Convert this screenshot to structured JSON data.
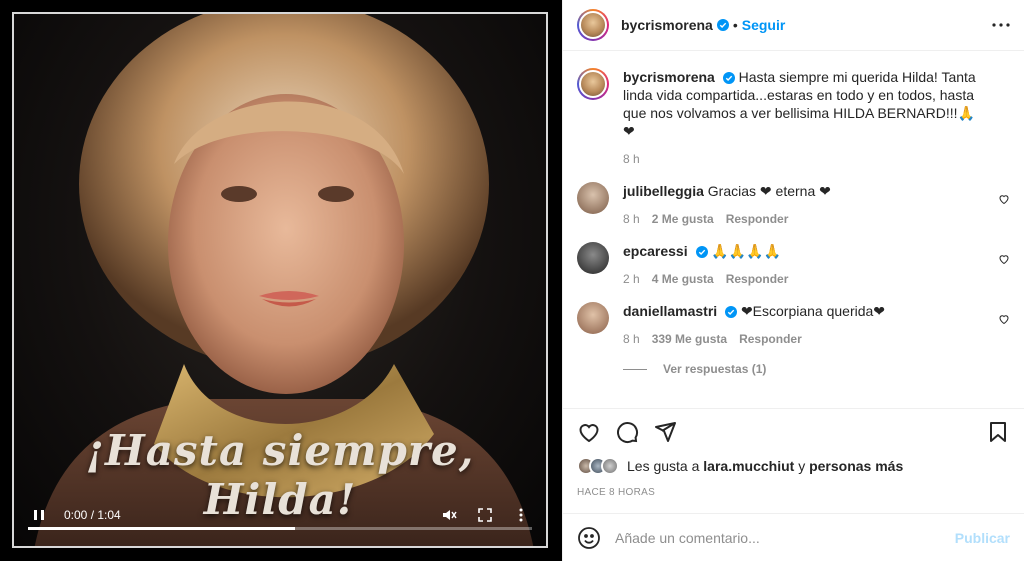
{
  "video": {
    "overlay_text": "¡Hasta siempre, Hilda!",
    "time": "0:00 / 1:04",
    "progress_fraction": 0.53,
    "icons": [
      "pause-icon",
      "mute-icon",
      "fullscreen-icon",
      "more-icon"
    ]
  },
  "header": {
    "username": "bycrismorena",
    "separator": "•",
    "follow_label": "Seguir"
  },
  "caption": {
    "username": "bycrismorena",
    "text": "Hasta siempre mi querida Hilda! Tanta linda vida compartida...estaras en todo y en todos, hasta que nos volvamos a ver bellisima HILDA BERNARD!!!🙏❤",
    "time": "8 h"
  },
  "comments": [
    {
      "username": "julibelleggia",
      "text": "Gracias ❤ eterna ❤",
      "time": "8 h",
      "likes": "2 Me gusta",
      "reply": "Responder",
      "verified": false
    },
    {
      "username": "epcaressi",
      "text": "🙏🙏🙏🙏",
      "time": "2 h",
      "likes": "4 Me gusta",
      "reply": "Responder",
      "verified": true
    },
    {
      "username": "daniellamastri",
      "text": "❤Escorpiana querida❤",
      "time": "8 h",
      "likes": "339 Me gusta",
      "reply": "Responder",
      "verified": true
    }
  ],
  "view_replies": "Ver respuestas (1)",
  "likes": {
    "prefix": "Les gusta a",
    "user": "lara.mucchiut",
    "middle": "y",
    "suffix": "personas más"
  },
  "posted": "HACE 8 HORAS",
  "add_comment": {
    "placeholder": "Añade un comentario...",
    "publish_label": "Publicar"
  },
  "colors": {
    "accent": "#0095f6",
    "publish_disabled": "#b2dffc",
    "heart": "#d61a2b",
    "muted": "#8e8e8e"
  }
}
